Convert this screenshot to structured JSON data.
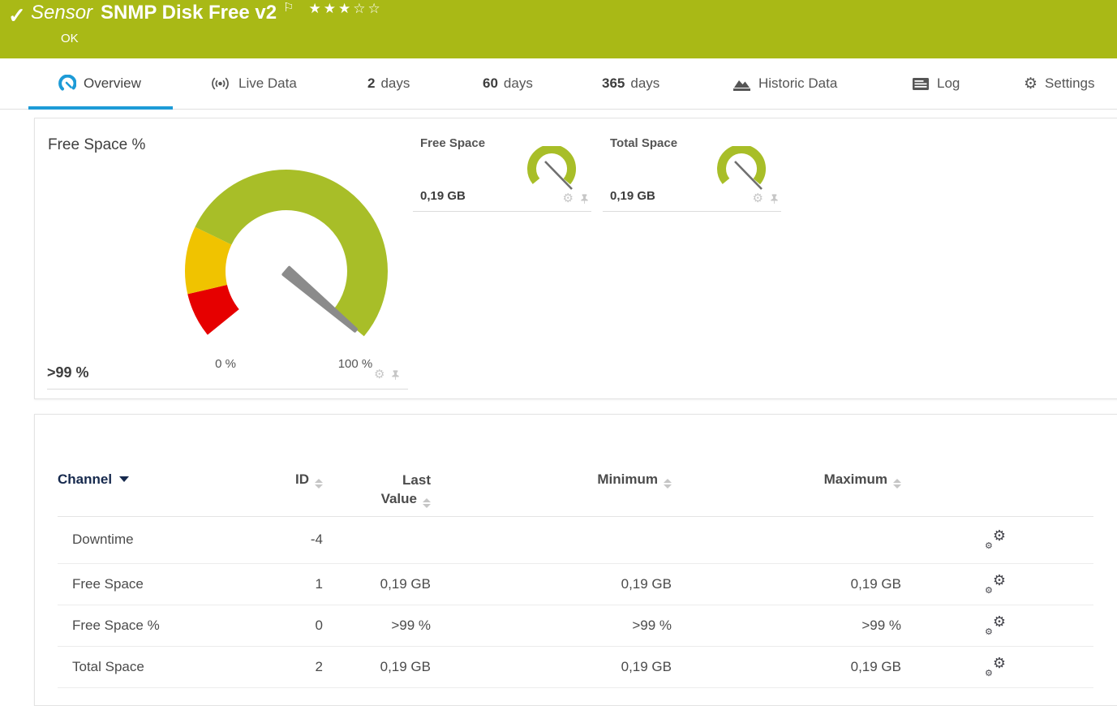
{
  "header": {
    "status_check": "✓",
    "sensor_type_label": "Sensor",
    "title": "SNMP Disk Free v2",
    "flag": "⚐",
    "stars_filled": "★★★",
    "stars_empty": "☆☆",
    "status": "OK",
    "bg_color": "#a9b916"
  },
  "tabs": [
    {
      "label": "Overview",
      "icon": "gauge-icon",
      "active": true
    },
    {
      "label": "Live Data",
      "icon": "broadcast-icon"
    },
    {
      "num": "2",
      "label": "days"
    },
    {
      "num": "60",
      "label": "days"
    },
    {
      "num": "365",
      "label": "days"
    },
    {
      "label": "Historic Data",
      "icon": "area-chart-icon"
    },
    {
      "label": "Log",
      "icon": "log-icon"
    },
    {
      "label": "Settings",
      "icon": "gear-icon"
    }
  ],
  "accent_blue": "#1d9bd7",
  "gauges": {
    "primary": {
      "title": "Free Space %",
      "value": ">99 %",
      "scale_min": "0 %",
      "scale_max": "100 %",
      "unit": "%",
      "range": [
        0,
        100
      ],
      "value_percent": 99.6,
      "zones": [
        {
          "from": 0,
          "to": 10,
          "color": "#e60000"
        },
        {
          "from": 10,
          "to": 25,
          "color": "#f0c300"
        },
        {
          "from": 25,
          "to": 100,
          "color": "#a8be28"
        }
      ]
    },
    "secondary": [
      {
        "title": "Free Space",
        "value": "0,19 GB",
        "color": "#a8be28"
      },
      {
        "title": "Total Space",
        "value": "0,19 GB",
        "color": "#a8be28"
      }
    ],
    "gear_glyph": "⚙"
  },
  "table": {
    "headers": {
      "channel": "Channel",
      "id": "ID",
      "last_line1": "Last",
      "last_line2": "Value",
      "min": "Minimum",
      "max": "Maximum"
    },
    "rows": [
      {
        "channel": "Downtime",
        "id": "-4",
        "last": "",
        "min": "",
        "max": ""
      },
      {
        "channel": "Free Space",
        "id": "1",
        "last": "0,19 GB",
        "min": "0,19 GB",
        "max": "0,19 GB"
      },
      {
        "channel": "Free Space %",
        "id": "0",
        "last": ">99 %",
        "min": ">99 %",
        "max": ">99 %"
      },
      {
        "channel": "Total Space",
        "id": "2",
        "last": "0,19 GB",
        "min": "0,19 GB",
        "max": "0,19 GB"
      }
    ],
    "gear_glyph": "⚙"
  }
}
